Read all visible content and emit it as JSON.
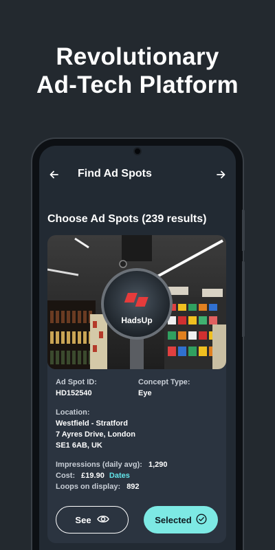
{
  "promo": {
    "line1": "Revolutionary",
    "line2": "Ad-Tech Platform"
  },
  "appbar": {
    "title": "Find Ad Spots",
    "back_icon": "arrow-left-icon",
    "forward_icon": "arrow-right-icon"
  },
  "section_title": "Choose Ad Spots (239 results)",
  "card": {
    "image_logo_text": "HadsUp",
    "ad_spot_id_label": "Ad Spot ID:",
    "ad_spot_id": "HD152540",
    "concept_type_label": "Concept Type:",
    "concept_type": "Eye",
    "location_label": "Location:",
    "location_line1": "Westfield - Stratford",
    "location_line2": "7 Ayres Drive, London",
    "location_line3": "SE1 6AB, UK",
    "impressions_label": "Impressions (daily avg):",
    "impressions": "1,290",
    "cost_label": "Cost:",
    "cost": "£19.90",
    "dates_link": "Dates",
    "loops_label": "Loops on display:",
    "loops": "892",
    "see_button": "See",
    "selected_button": "Selected"
  },
  "colors": {
    "background": "#23292f",
    "screen": "#222a33",
    "card": "#2b3440",
    "accent": "#62e3e8",
    "selected_button": "#7de9e4"
  }
}
